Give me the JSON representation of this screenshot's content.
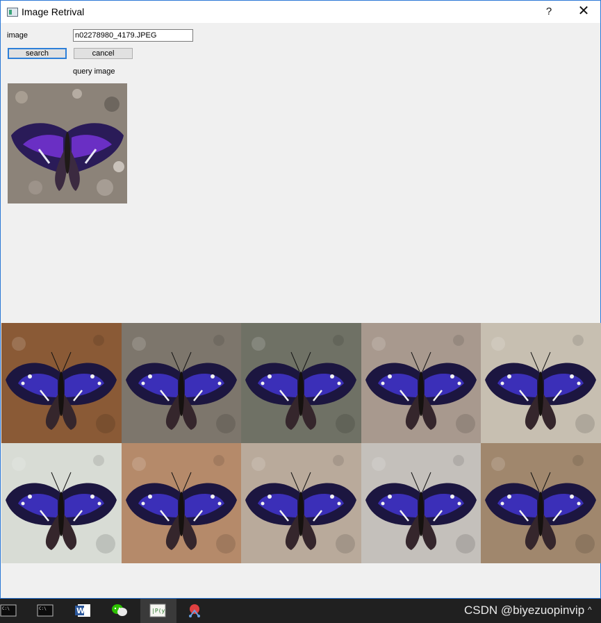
{
  "window": {
    "title": "Image Retrival",
    "help_label": "?",
    "close_label": "✕"
  },
  "form": {
    "image_label": "image",
    "image_value": "n02278980_4179.JPEG",
    "search_label": "search",
    "cancel_label": "cancel",
    "query_label": "query image"
  },
  "results": {
    "tiles": [
      {
        "bg": "#8a5a36"
      },
      {
        "bg": "#7d766c"
      },
      {
        "bg": "#6f7165"
      },
      {
        "bg": "#a8998e"
      },
      {
        "bg": "#c7bfb1"
      },
      {
        "bg": "#d8dcd5"
      },
      {
        "bg": "#b58a6a"
      },
      {
        "bg": "#b9aa9b"
      },
      {
        "bg": "#c4c0bb"
      },
      {
        "bg": "#a0876d"
      }
    ]
  },
  "taskbar": {
    "watermark": "CSDN @biyezuopinvip",
    "caret": "^",
    "icons": [
      "terminal-icon",
      "terminal-icon-2",
      "word-icon",
      "wechat-icon",
      "python-icon",
      "snipping-tool-icon"
    ]
  }
}
